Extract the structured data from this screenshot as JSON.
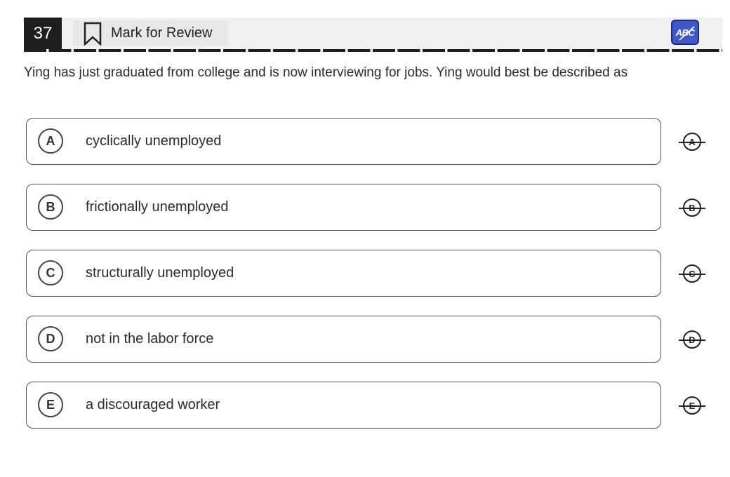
{
  "header": {
    "question_number": "37",
    "mark_for_review_label": "Mark for Review",
    "bookmark_icon": "bookmark-icon",
    "eliminator_button_text": "ABC",
    "eliminator_color": "#3f57c9"
  },
  "question": {
    "text": "Ying has just graduated from college and is now interviewing for jobs. Ying would best be described as"
  },
  "choices": [
    {
      "letter": "A",
      "text": "cyclically unemployed"
    },
    {
      "letter": "B",
      "text": "frictionally unemployed"
    },
    {
      "letter": "C",
      "text": "structurally unemployed"
    },
    {
      "letter": "D",
      "text": "not in the labor force"
    },
    {
      "letter": "E",
      "text": "a discouraged worker"
    }
  ]
}
